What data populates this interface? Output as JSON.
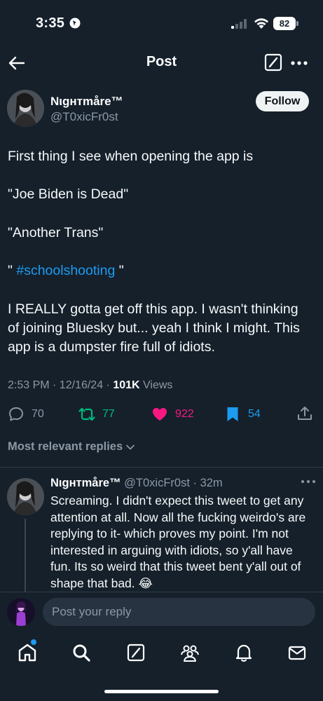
{
  "status_bar": {
    "time": "3:35",
    "battery": "82"
  },
  "header": {
    "title": "Post"
  },
  "tweet": {
    "author_name": "Nιgнтmåre™",
    "author_handle": "@T0xicFr0st",
    "follow_label": "Follow",
    "lines": [
      "First thing I see when opening the app is",
      "\"Joe Biden is Dead\"",
      "\"Another Trans\""
    ],
    "hashtag_prefix": "\"",
    "hashtag": "#schoolshooting",
    "hashtag_suffix": "\"",
    "lines2": [
      "I REALLY gotta get off this app. I wasn't thinking",
      "of joining Bluesky but... yeah I think I might. This",
      "app is a dumpster fire full of idiots."
    ],
    "timestamp": "2:53 PM · 12/16/24 · ",
    "views_count": "101K",
    "views_label": " Views"
  },
  "actions": {
    "replies": "70",
    "reposts": "77",
    "likes": "922",
    "bookmarks": "54"
  },
  "colors": {
    "background": "#15202b",
    "accent": "#1d9bf0",
    "repost": "#00ba7c",
    "like": "#f91880"
  },
  "replies_sort": "Most relevant replies",
  "reply": {
    "author_name": "Nιgнтmåre™",
    "handle_time": " @T0xicFr0st · 32m",
    "lines": [
      "Screaming. I didn't expect this tweet to get any",
      "attention at all. Now all the fucking weirdo's are",
      "replying to it- which proves my point. I'm not",
      "interested in arguing with idiots, so y'all have",
      "fun. Its so weird that this tweet bent y'all out of",
      "shape that bad. 😂"
    ]
  },
  "compose": {
    "placeholder": "Post your reply"
  },
  "nav": [
    "home-icon",
    "search-icon",
    "grok-icon",
    "communities-icon",
    "notifications-icon",
    "messages-icon"
  ]
}
